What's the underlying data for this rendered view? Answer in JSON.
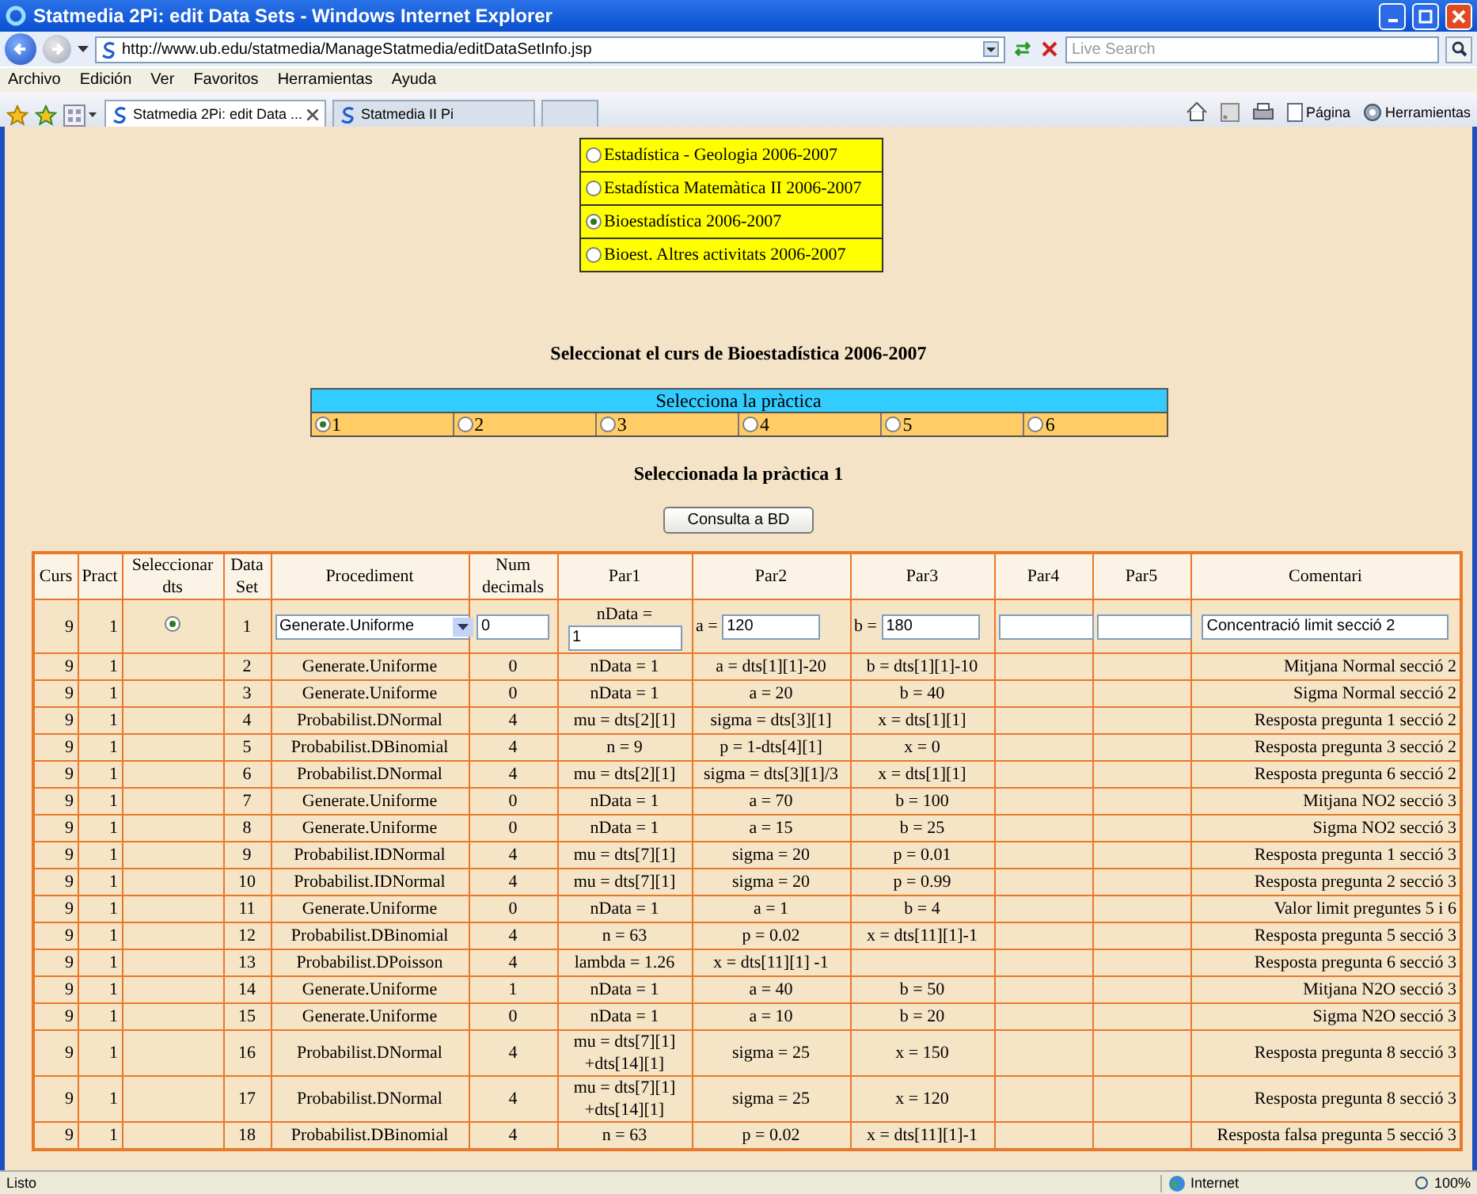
{
  "window": {
    "title": "Statmedia 2Pi: edit Data Sets - Windows Internet Explorer"
  },
  "address_bar": {
    "url": "http://www.ub.edu/statmedia/ManageStatmedia/editDataSetInfo.jsp"
  },
  "search": {
    "placeholder": "Live Search"
  },
  "menu": [
    "Archivo",
    "Edición",
    "Ver",
    "Favoritos",
    "Herramientas",
    "Ayuda"
  ],
  "tabs": [
    {
      "label": "Statmedia 2Pi: edit Data ...",
      "selected": true
    },
    {
      "label": "Statmedia II Pi",
      "selected": false
    }
  ],
  "toolbar": [
    {
      "kind": "home"
    },
    {
      "kind": "feed"
    },
    {
      "kind": "print"
    },
    {
      "kind": "page",
      "label": "Página"
    },
    {
      "kind": "tools",
      "label": "Herramientas"
    }
  ],
  "courses": [
    {
      "label": "Estadística - Geologia 2006-2007",
      "selected": false
    },
    {
      "label": "Estadística Matemàtica II 2006-2007",
      "selected": false
    },
    {
      "label": "Bioestadística 2006-2007",
      "selected": true
    },
    {
      "label": "Bioest. Altres activitats 2006-2007",
      "selected": false
    }
  ],
  "course_heading": "Seleccionat el curs de Bioestadística 2006-2007",
  "practice_selector": {
    "title": "Selecciona la pràctica",
    "options": [
      {
        "label": "1",
        "selected": true
      },
      {
        "label": "2",
        "selected": false
      },
      {
        "label": "3",
        "selected": false
      },
      {
        "label": "4",
        "selected": false
      },
      {
        "label": "5",
        "selected": false
      },
      {
        "label": "6",
        "selected": false
      }
    ]
  },
  "practice_heading": "Seleccionada la pràctica 1",
  "query_button": "Consulta a BD",
  "table": {
    "columns": [
      "Curs",
      "Pract",
      "Seleccionar dts",
      "Data Set",
      "Procediment",
      "Num decimals",
      "Par1",
      "Par2",
      "Par3",
      "Par4",
      "Par5",
      "Comentari"
    ],
    "edit_row": {
      "curs": "9",
      "pract": "1",
      "selected": true,
      "data_set": "1",
      "procedure": "Generate.Uniforme",
      "decimals": "0",
      "par1_label": "nData =",
      "par1": "1",
      "par2_label": "a =",
      "par2": "120",
      "par3_label": "b =",
      "par3": "180",
      "comment": "Concentració limit secció 2"
    },
    "rows": [
      {
        "curs": "9",
        "pract": "1",
        "data_set": "2",
        "procedure": "Generate.Uniforme",
        "decimals": "0",
        "par1": "nData = 1",
        "par2": "a = dts[1][1]-20",
        "par3": "b = dts[1][1]-10",
        "comment": "Mitjana Normal secció 2"
      },
      {
        "curs": "9",
        "pract": "1",
        "data_set": "3",
        "procedure": "Generate.Uniforme",
        "decimals": "0",
        "par1": "nData = 1",
        "par2": "a = 20",
        "par3": "b = 40",
        "comment": "Sigma Normal secció 2"
      },
      {
        "curs": "9",
        "pract": "1",
        "data_set": "4",
        "procedure": "Probabilist.DNormal",
        "decimals": "4",
        "par1": "mu = dts[2][1]",
        "par2": "sigma = dts[3][1]",
        "par3": "x = dts[1][1]",
        "comment": "Resposta pregunta 1 secció 2"
      },
      {
        "curs": "9",
        "pract": "1",
        "data_set": "5",
        "procedure": "Probabilist.DBinomial",
        "decimals": "4",
        "par1": "n = 9",
        "par2": "p = 1-dts[4][1]",
        "par3": "x = 0",
        "comment": "Resposta pregunta 3 secció 2"
      },
      {
        "curs": "9",
        "pract": "1",
        "data_set": "6",
        "procedure": "Probabilist.DNormal",
        "decimals": "4",
        "par1": "mu = dts[2][1]",
        "par2": "sigma = dts[3][1]/3",
        "par3": "x = dts[1][1]",
        "comment": "Resposta pregunta 6 secció 2"
      },
      {
        "curs": "9",
        "pract": "1",
        "data_set": "7",
        "procedure": "Generate.Uniforme",
        "decimals": "0",
        "par1": "nData = 1",
        "par2": "a = 70",
        "par3": "b = 100",
        "comment": "Mitjana NO2 secció 3"
      },
      {
        "curs": "9",
        "pract": "1",
        "data_set": "8",
        "procedure": "Generate.Uniforme",
        "decimals": "0",
        "par1": "nData = 1",
        "par2": "a = 15",
        "par3": "b = 25",
        "comment": "Sigma NO2 secció 3"
      },
      {
        "curs": "9",
        "pract": "1",
        "data_set": "9",
        "procedure": "Probabilist.IDNormal",
        "decimals": "4",
        "par1": "mu = dts[7][1]",
        "par2": "sigma = 20",
        "par3": "p = 0.01",
        "comment": "Resposta pregunta 1 secció 3"
      },
      {
        "curs": "9",
        "pract": "1",
        "data_set": "10",
        "procedure": "Probabilist.IDNormal",
        "decimals": "4",
        "par1": "mu = dts[7][1]",
        "par2": "sigma = 20",
        "par3": "p = 0.99",
        "comment": "Resposta pregunta 2 secció 3"
      },
      {
        "curs": "9",
        "pract": "1",
        "data_set": "11",
        "procedure": "Generate.Uniforme",
        "decimals": "0",
        "par1": "nData = 1",
        "par2": "a = 1",
        "par3": "b = 4",
        "comment": "Valor limit preguntes 5 i 6"
      },
      {
        "curs": "9",
        "pract": "1",
        "data_set": "12",
        "procedure": "Probabilist.DBinomial",
        "decimals": "4",
        "par1": "n = 63",
        "par2": "p = 0.02",
        "par3": "x = dts[11][1]-1",
        "comment": "Resposta pregunta 5 secció 3"
      },
      {
        "curs": "9",
        "pract": "1",
        "data_set": "13",
        "procedure": "Probabilist.DPoisson",
        "decimals": "4",
        "par1": "lambda = 1.26",
        "par2": "x = dts[11][1] -1",
        "comment": "Resposta pregunta 6 secció 3"
      },
      {
        "curs": "9",
        "pract": "1",
        "data_set": "14",
        "procedure": "Generate.Uniforme",
        "decimals": "1",
        "par1": "nData = 1",
        "par2": "a = 40",
        "par3": "b = 50",
        "comment": "Mitjana N2O secció 3"
      },
      {
        "curs": "9",
        "pract": "1",
        "data_set": "15",
        "procedure": "Generate.Uniforme",
        "decimals": "0",
        "par1": "nData = 1",
        "par2": "a = 10",
        "par3": "b = 20",
        "comment": "Sigma N2O secció 3"
      },
      {
        "curs": "9",
        "pract": "1",
        "data_set": "16",
        "procedure": "Probabilist.DNormal",
        "decimals": "4",
        "par1": "mu = dts[7][1] +dts[14][1]",
        "par2": "sigma = 25",
        "par3": "x = 150",
        "comment": "Resposta pregunta 8 secció 3"
      },
      {
        "curs": "9",
        "pract": "1",
        "data_set": "17",
        "procedure": "Probabilist.DNormal",
        "decimals": "4",
        "par1": "mu = dts[7][1] +dts[14][1]",
        "par2": "sigma = 25",
        "par3": "x = 120",
        "comment": "Resposta pregunta 8 secció 3"
      },
      {
        "curs": "9",
        "pract": "1",
        "data_set": "18",
        "procedure": "Probabilist.DBinomial",
        "decimals": "4",
        "par1": "n = 63",
        "par2": "p = 0.02",
        "par3": "x = dts[11][1]-1",
        "comment": "Resposta falsa pregunta 5 secció 3"
      }
    ]
  },
  "status_bar": {
    "text": "Listo",
    "zone": "Internet",
    "zoom": "100%"
  }
}
